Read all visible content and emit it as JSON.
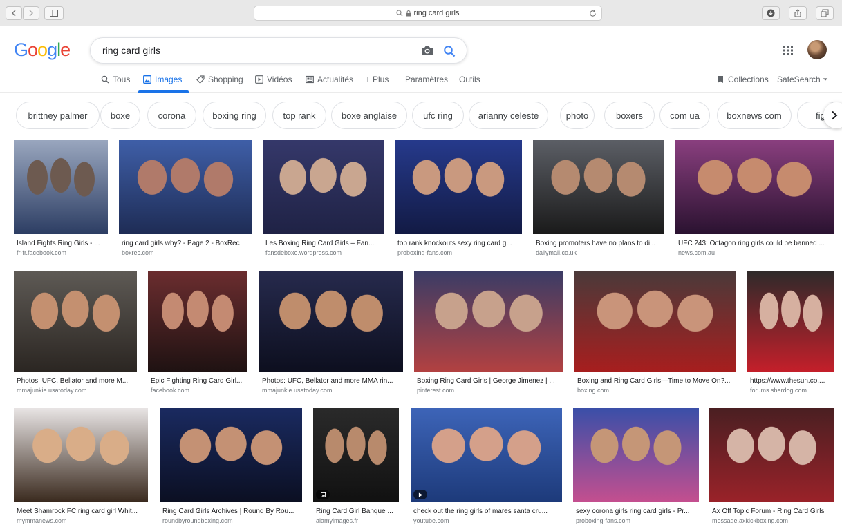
{
  "browser": {
    "url": "ring card girls"
  },
  "header": {
    "logo_letters": [
      {
        "char": "G",
        "color": "#4285f4"
      },
      {
        "char": "o",
        "color": "#ea4335"
      },
      {
        "char": "o",
        "color": "#fbbc05"
      },
      {
        "char": "g",
        "color": "#4285f4"
      },
      {
        "char": "l",
        "color": "#34a853"
      },
      {
        "char": "e",
        "color": "#ea4335"
      }
    ],
    "search_value": "ring card girls"
  },
  "tabs": {
    "all": "Tous",
    "images": "Images",
    "shopping": "Shopping",
    "videos": "Vidéos",
    "news": "Actualités",
    "more": "Plus",
    "settings": "Paramètres",
    "tools": "Outils",
    "collections": "Collections",
    "safesearch": "SafeSearch"
  },
  "chips": [
    "brittney palmer",
    "boxe",
    "corona",
    "boxing ring",
    "top rank",
    "boxe anglaise",
    "ufc ring",
    "arianny celeste",
    "photo",
    "boxers",
    "com ua",
    "boxnews com",
    "fight"
  ],
  "results": [
    {
      "title": "Island Fights Ring Girls - ...",
      "source": "fr-fr.facebook.com",
      "tone": [
        "#9aa7bf",
        "#6d5a50",
        "#2c3d63"
      ]
    },
    {
      "title": "ring card girls why? - Page 2 - BoxRec",
      "source": "boxrec.com",
      "tone": [
        "#3f5fa8",
        "#b07a6a",
        "#1e2c55"
      ]
    },
    {
      "title": "Les Boxing Ring Card Girls – Fan...",
      "source": "fansdeboxe.wordpress.com",
      "tone": [
        "#35386a",
        "#c9a690",
        "#1f2245"
      ]
    },
    {
      "title": "top rank knockouts sexy ring card g...",
      "source": "proboxing-fans.com",
      "tone": [
        "#263a8c",
        "#c9997f",
        "#121a44"
      ]
    },
    {
      "title": "Boxing promoters have no plans to di...",
      "source": "dailymail.co.uk",
      "tone": [
        "#5c5f66",
        "#b58a70",
        "#1a1a1a"
      ]
    },
    {
      "title": "UFC 243: Octagon ring girls could be banned ...",
      "source": "news.com.au",
      "tone": [
        "#8a3f7f",
        "#c68b6e",
        "#2a1230"
      ]
    },
    {
      "title": "Photos: UFC, Bellator and more M...",
      "source": "mmajunkie.usatoday.com",
      "tone": [
        "#5e5a55",
        "#c49070",
        "#2b2622"
      ]
    },
    {
      "title": "Epic Fighting Ring Card Girl...",
      "source": "facebook.com",
      "tone": [
        "#6b2d2f",
        "#c48a72",
        "#1f1212"
      ]
    },
    {
      "title": "Photos: UFC, Bellator and more MMA rin...",
      "source": "mmajunkie.usatoday.com",
      "tone": [
        "#262a4d",
        "#bf8d6c",
        "#0d0f1f"
      ]
    },
    {
      "title": "Boxing Ring Card Girls | George Jimenez | ...",
      "source": "pinterest.com",
      "tone": [
        "#3a3c66",
        "#c7a18c",
        "#b24141"
      ]
    },
    {
      "title": "Boxing and Ring Card Girls—Time to Move On?...",
      "source": "boxing.com",
      "tone": [
        "#4a3a3a",
        "#c9947a",
        "#a71e1e"
      ]
    },
    {
      "title": "https://www.thesun.co....",
      "source": "forums.sherdog.com",
      "tone": [
        "#2e2a2a",
        "#d6b0a0",
        "#c41f2a"
      ]
    },
    {
      "title": "Meet Shamrock FC ring card girl Whit...",
      "source": "mymmanews.com",
      "tone": [
        "#e8e4e4",
        "#d9ad88",
        "#3a2a1e"
      ]
    },
    {
      "title": "Ring Card Girls Archives | Round By Rou...",
      "source": "roundbyroundboxing.com",
      "tone": [
        "#1a2a60",
        "#c49174",
        "#0b0f22"
      ]
    },
    {
      "title": "Ring Card Girl Banque ...",
      "source": "alamyimages.fr",
      "tone": [
        "#2a2a2a",
        "#b88a6c",
        "#111111"
      ]
    },
    {
      "title": "check out the ring girls of mares santa cru...",
      "source": "youtube.com",
      "tone": [
        "#3d64b8",
        "#d4a08a",
        "#1d3a7a"
      ]
    },
    {
      "title": "sexy corona girls ring card girls - Pr...",
      "source": "proboxing-fans.com",
      "tone": [
        "#3a4fa8",
        "#c59677",
        "#c44f8f"
      ]
    },
    {
      "title": "Ax Off Topic Forum - Ring Card Girls",
      "source": "message.axkickboxing.com",
      "tone": [
        "#4a1f22",
        "#d5b4a6",
        "#9a2229"
      ]
    }
  ]
}
